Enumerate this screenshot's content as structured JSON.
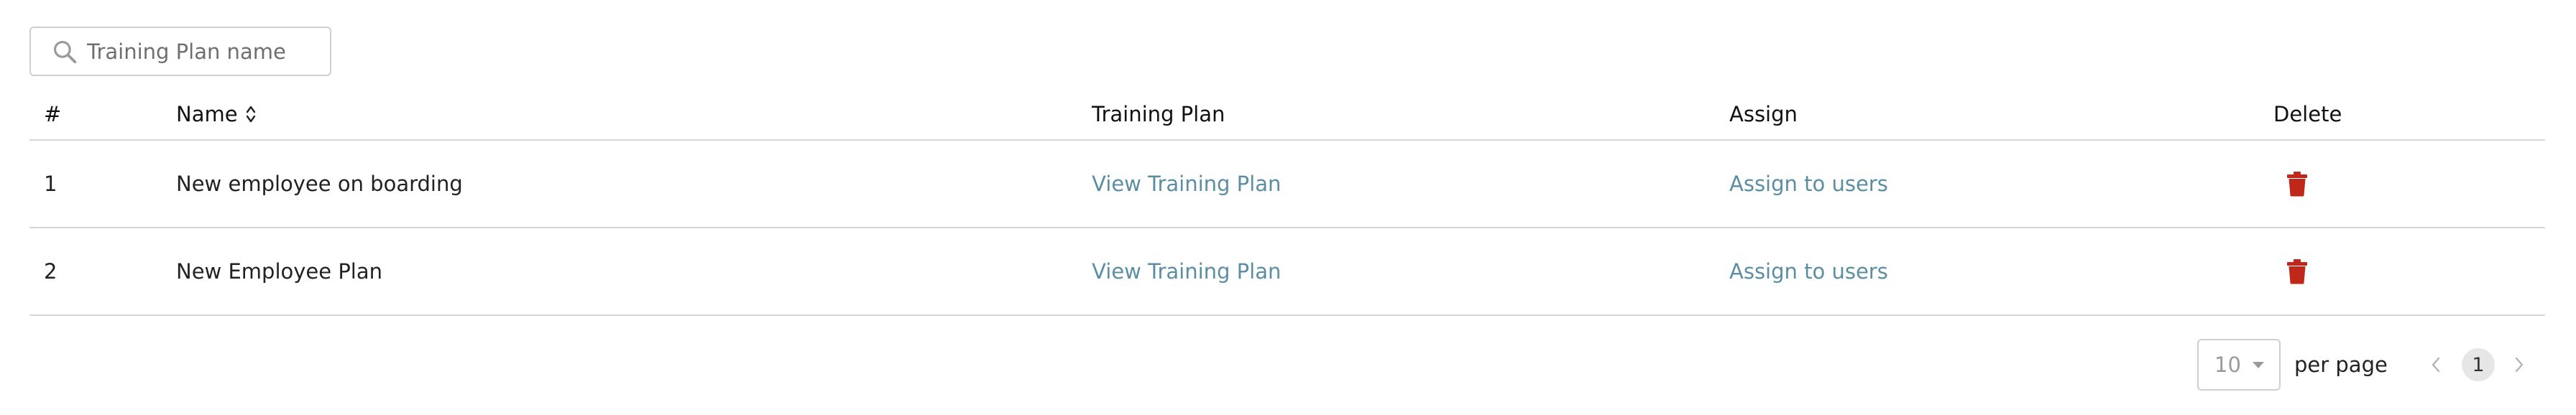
{
  "search": {
    "placeholder": "Training Plan name",
    "icon": "search-icon"
  },
  "table": {
    "headers": {
      "num": "#",
      "name": "Name",
      "plan": "Training Plan",
      "assign": "Assign",
      "delete": "Delete"
    },
    "rows": [
      {
        "num": "1",
        "name": "New employee on boarding",
        "plan_link": "View Training Plan",
        "assign_link": "Assign to users"
      },
      {
        "num": "2",
        "name": "New Employee Plan",
        "plan_link": "View Training Plan",
        "assign_link": "Assign to users"
      }
    ]
  },
  "pagination": {
    "per_page_value": "10",
    "per_page_label": "per page",
    "current_page": "1"
  },
  "colors": {
    "link": "#5b8ea3",
    "delete_icon": "#c0271b",
    "border": "#d6d6d6"
  }
}
